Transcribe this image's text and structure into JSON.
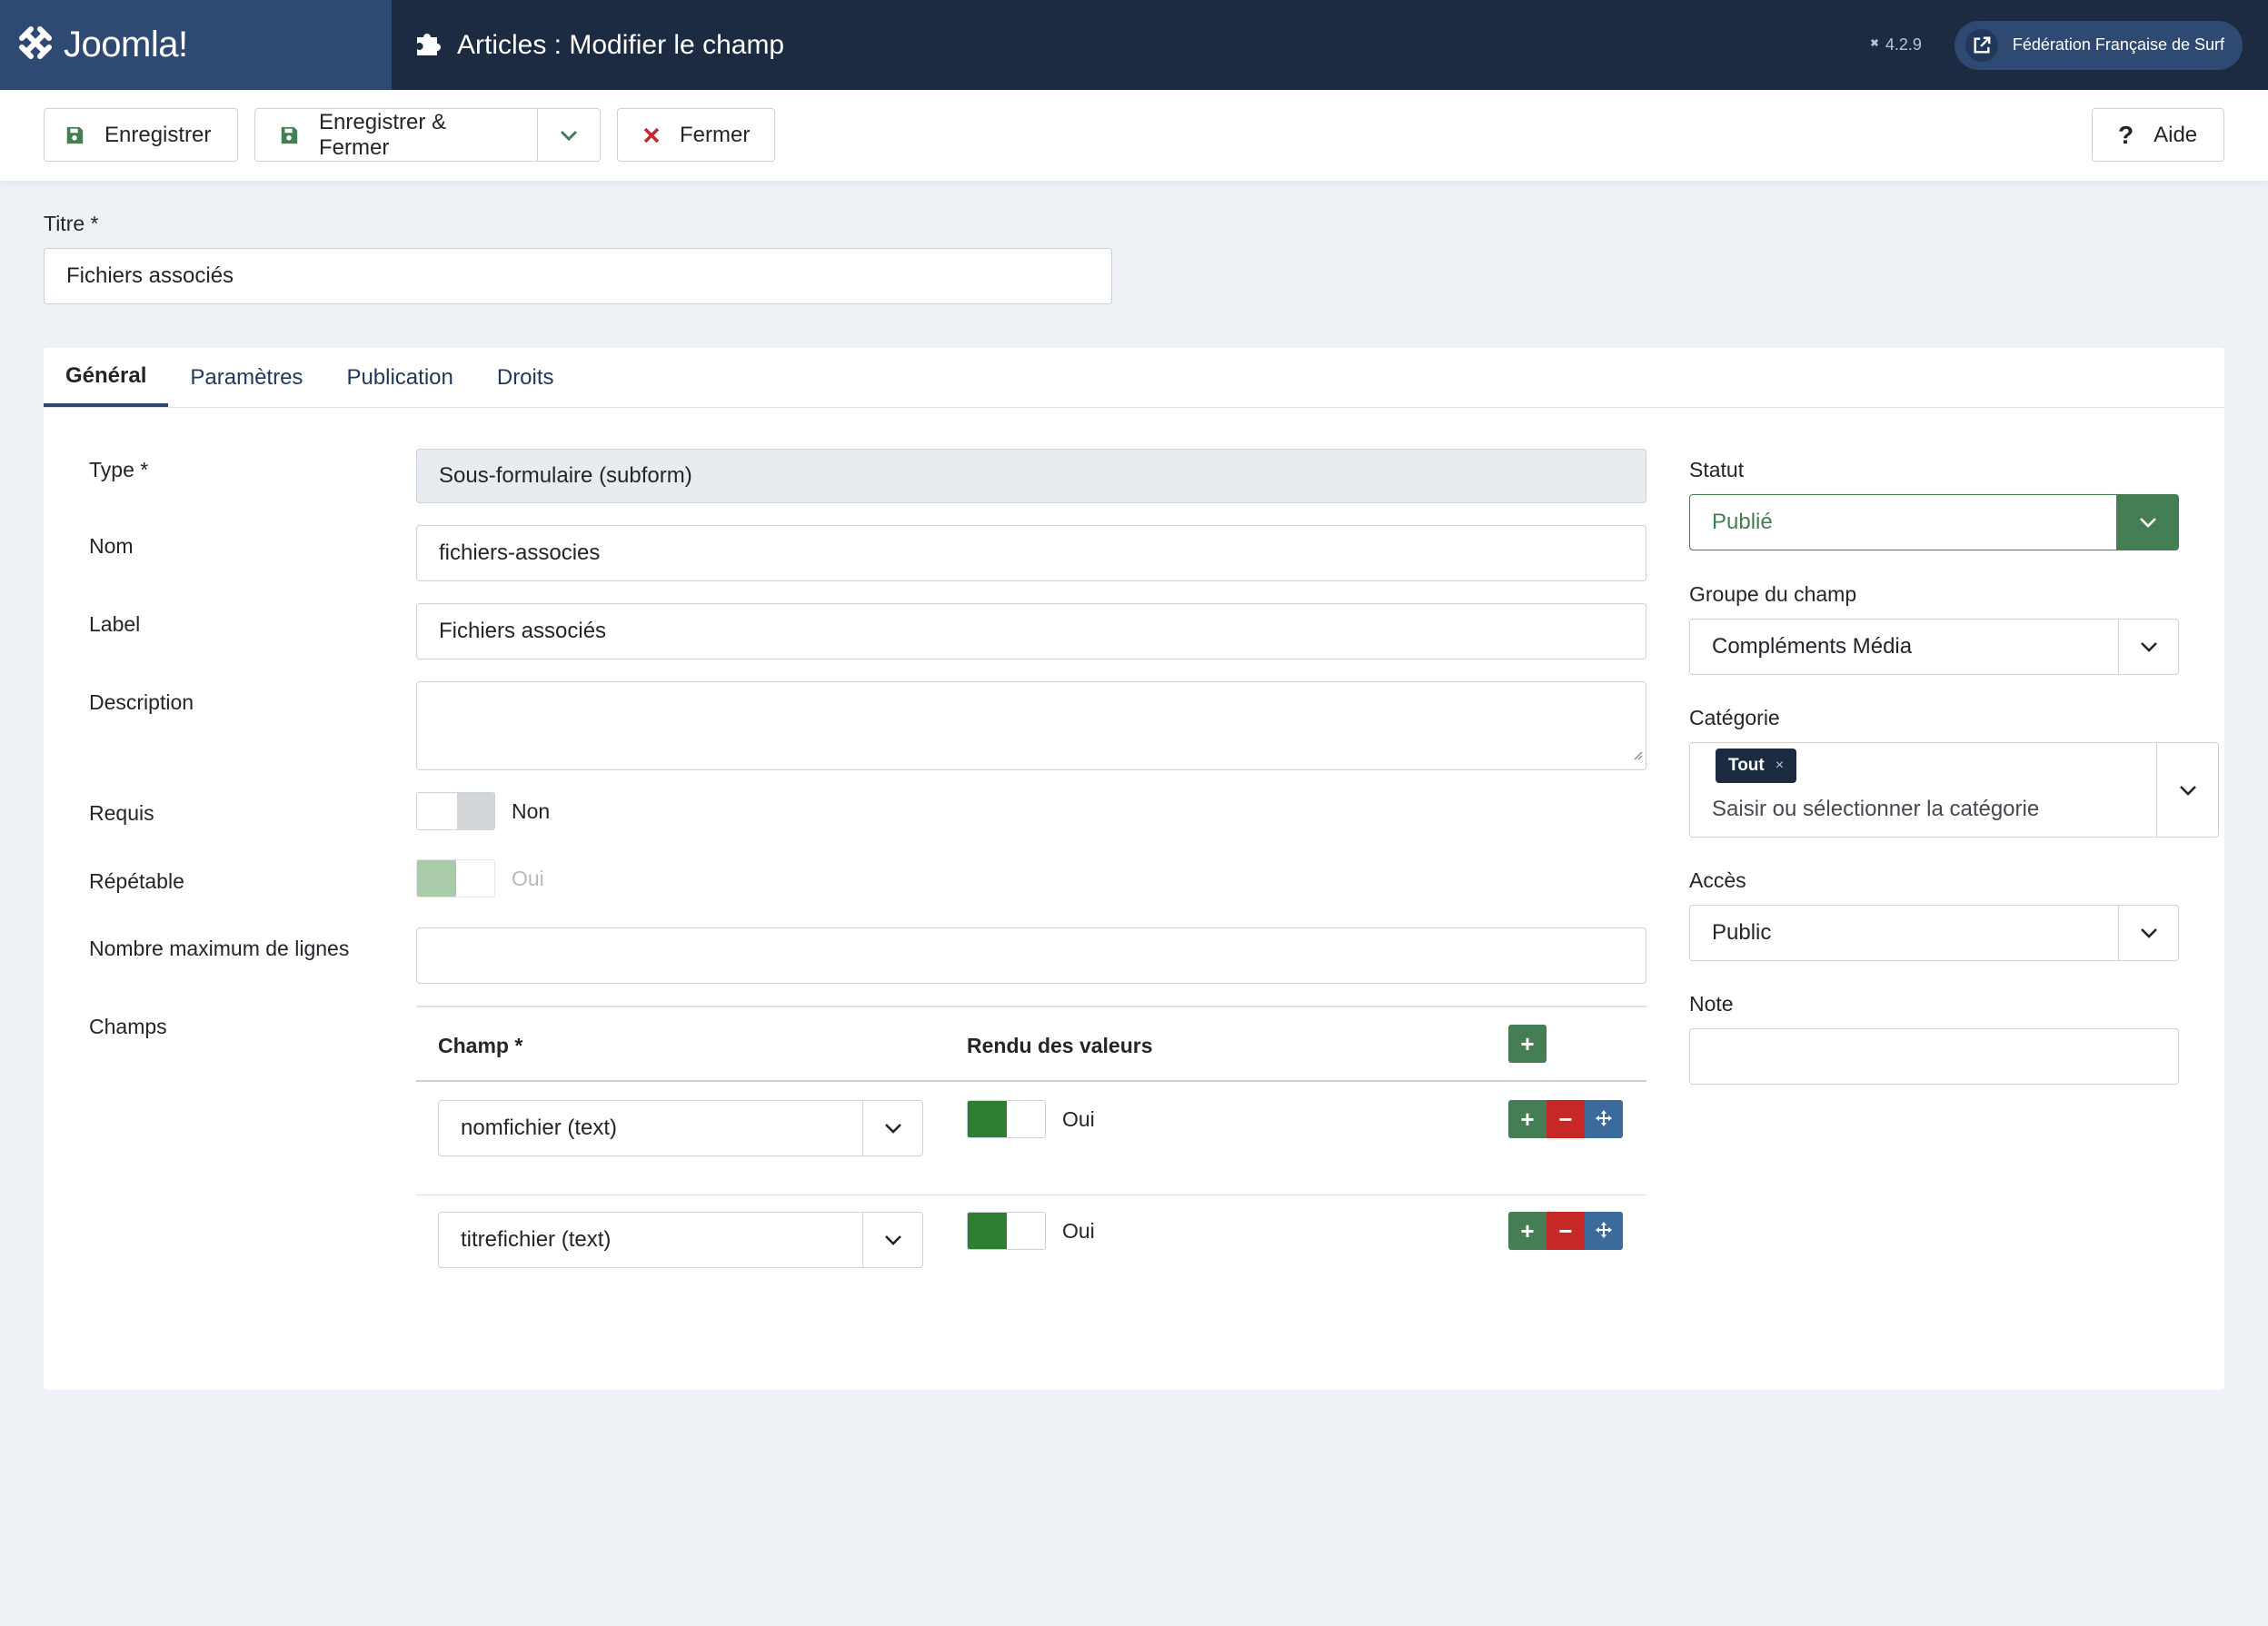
{
  "header": {
    "logo_text": "Joomla!",
    "page_title": "Articles : Modifier le champ",
    "version": "4.2.9",
    "site_name": "Fédération Française de Surf"
  },
  "toolbar": {
    "save": "Enregistrer",
    "save_close": "Enregistrer & Fermer",
    "close": "Fermer",
    "help": "Aide"
  },
  "title_field": {
    "label": "Titre *",
    "value": "Fichiers associés"
  },
  "tabs": [
    "Général",
    "Paramètres",
    "Publication",
    "Droits"
  ],
  "general": {
    "type_label": "Type *",
    "type_value": "Sous-formulaire (subform)",
    "name_label": "Nom",
    "name_value": "fichiers-associes",
    "label_label": "Label",
    "label_value": "Fichiers associés",
    "description_label": "Description",
    "description_value": "",
    "required_label": "Requis",
    "required_value": "Non",
    "repeatable_label": "Répétable",
    "repeatable_value": "Oui",
    "max_rows_label": "Nombre maximum de lignes",
    "max_rows_value": "",
    "fields_label": "Champs",
    "subform": {
      "col_field": "Champ *",
      "col_render": "Rendu des valeurs",
      "rows": [
        {
          "field": "nomfichier (text)",
          "render": "Oui"
        },
        {
          "field": "titrefichier (text)",
          "render": "Oui"
        }
      ]
    }
  },
  "sidebar": {
    "status_label": "Statut",
    "status_value": "Publié",
    "group_label": "Groupe du champ",
    "group_value": "Compléments Média",
    "category_label": "Catégorie",
    "category_tag": "Tout",
    "category_placeholder": "Saisir ou sélectionner la catégorie",
    "access_label": "Accès",
    "access_value": "Public",
    "note_label": "Note",
    "note_value": ""
  },
  "colors": {
    "header_bg": "#1c2b41",
    "logo_bg": "#2f4a72",
    "success": "#457d54",
    "danger": "#c52827",
    "toggle_on": "#2e7d32"
  },
  "icons": [
    "joomla-logo-icon",
    "puzzle-icon",
    "external-link-icon",
    "save-icon",
    "chevron-down-icon",
    "close-x-icon",
    "question-icon",
    "plus-icon",
    "minus-icon",
    "move-icon"
  ]
}
